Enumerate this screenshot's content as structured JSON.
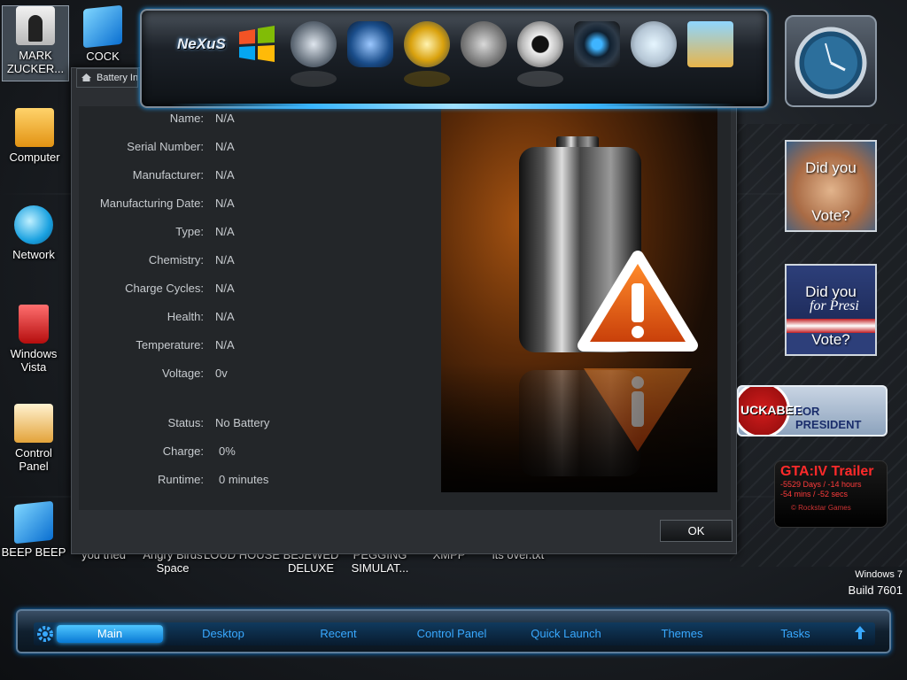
{
  "desktop_icons": [
    {
      "label": "MARK ZUCKER..."
    },
    {
      "label": "COCK"
    },
    {
      "label": "Computer"
    },
    {
      "label": "Network"
    },
    {
      "label": "Windows Vista"
    },
    {
      "label": "Control Panel"
    },
    {
      "label": "BEEP BEEP"
    }
  ],
  "hidden_icon_labels": [
    "you tried",
    "Angry Birds Space",
    "LOUD HOUSE",
    "BEJEWED DELUXE",
    "PEGGING SIMULAT...",
    "XMPP",
    "its over.txt"
  ],
  "dialog": {
    "tab_title": "Battery In",
    "fields": [
      {
        "label": "Name:",
        "value": "N/A"
      },
      {
        "label": "Serial Number:",
        "value": "N/A"
      },
      {
        "label": "Manufacturer:",
        "value": "N/A"
      },
      {
        "label": "Manufacturing Date:",
        "value": "N/A"
      },
      {
        "label": "Type:",
        "value": "N/A"
      },
      {
        "label": "Chemistry:",
        "value": "N/A"
      },
      {
        "label": "Charge Cycles:",
        "value": "N/A"
      },
      {
        "label": "Health:",
        "value": "N/A"
      },
      {
        "label": "Temperature:",
        "value": "N/A"
      },
      {
        "label": "Voltage:",
        "value": "0v"
      }
    ],
    "status": [
      {
        "label": "Status:",
        "value": "No Battery"
      },
      {
        "label": "Charge:",
        "value": "0%"
      },
      {
        "label": "Runtime:",
        "value": "0 minutes"
      }
    ],
    "ok_label": "OK"
  },
  "dock": {
    "items": [
      "nexus-logo",
      "windows-logo",
      "clock",
      "weapon-emblem",
      "globe",
      "bell",
      "webcam",
      "camera",
      "speedometer",
      "game-character"
    ],
    "logo_text": "NeXuS"
  },
  "gadgets": {
    "vote1": {
      "top": "Did you",
      "bottom": "Vote?"
    },
    "vote2": {
      "top": "Did you",
      "bottom": "Vote?",
      "overlay": "for Presi"
    },
    "huckabee": {
      "name": "UCKABEE",
      "tag": "FOR PRESIDENT"
    },
    "gta": {
      "title": "GTA:IV Trailer",
      "line1": "-5529 Days / -14 hours",
      "line2": "-54 mins / -52 secs",
      "credit": "© Rockstar Games"
    }
  },
  "os": {
    "name": "Windows 7",
    "build": "Build 7601"
  },
  "taskbar": {
    "items": [
      "Main",
      "Desktop",
      "Recent",
      "Control Panel",
      "Quick Launch",
      "Themes",
      "Tasks"
    ],
    "active": "Main"
  },
  "colors": {
    "accent": "#39a9ff",
    "dialog_bg": "#2c2f33",
    "warning": "#e0631a"
  }
}
